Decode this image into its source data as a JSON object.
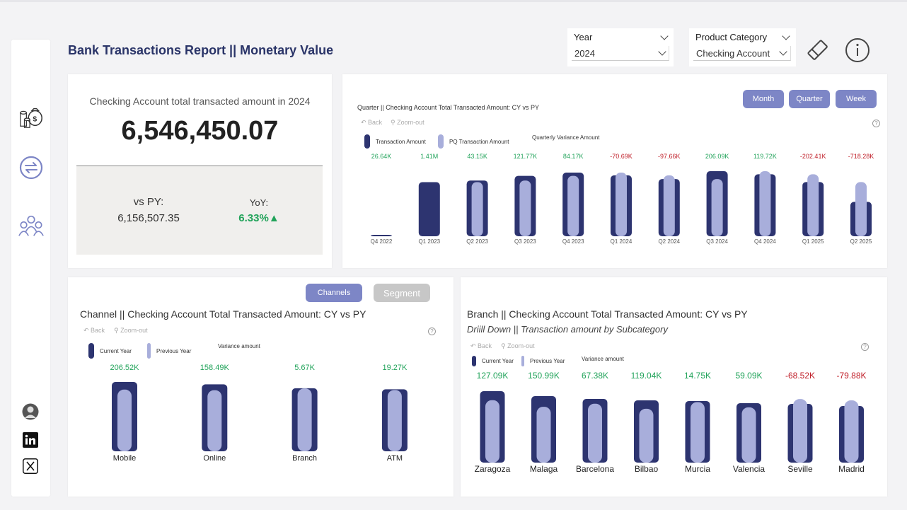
{
  "header": {
    "title": "Bank Transactions Report || Monetary Value"
  },
  "filters": {
    "year": {
      "label": "Year",
      "value": "2024"
    },
    "product": {
      "label": "Product Category",
      "value": "Checking Account"
    }
  },
  "sidebar": {
    "icons": [
      "money-bags-icon",
      "exchange-icon",
      "people-group-icon"
    ],
    "social": [
      "avatar",
      "linkedin-icon",
      "x-twitter-icon"
    ]
  },
  "kpi": {
    "subtitle": "Checking Account total transacted amount in 2024",
    "main_value": "6,546,450.07",
    "vs_label": "vs PY:",
    "vs_value": "6,156,507.35",
    "yoy_label": "YoY:",
    "yoy_value": "6.33%▲"
  },
  "buttons": {
    "month": "Month",
    "quarter": "Quarter",
    "week": "Week",
    "channels": "Channels",
    "segment": "Segment"
  },
  "nav": {
    "back": "Back",
    "zoom_out": "Zoom-out",
    "help": "?"
  },
  "colors": {
    "current": "#2d3470",
    "previous": "#a8aedb",
    "positive": "#21a35a",
    "negative": "#c0202a",
    "accent": "#7d86c6"
  },
  "chart_data": [
    {
      "type": "bar",
      "title": "Quarter || Checking Account Total Transacted Amount: CY vs PY",
      "legend": [
        "Transaction Amount",
        "PQ Transaction Amount",
        "Quarterly Variance Amount"
      ],
      "categories": [
        "Q4 2022",
        "Q1 2023",
        "Q2 2023",
        "Q3 2023",
        "Q4 2023",
        "Q1 2024",
        "Q2 2024",
        "Q3 2024",
        "Q4 2024",
        "Q1 2025",
        "Q2 2025"
      ],
      "series": [
        {
          "name": "Transaction Amount",
          "values": [
            26640,
            1410000,
            1453150,
            1574910,
            1659080,
            1588390,
            1490730,
            1696820,
            1616540,
            1414130,
            895850
          ]
        },
        {
          "name": "PQ Transaction Amount",
          "values": [
            0,
            0,
            1410000,
            1453150,
            1574910,
            1659080,
            1588390,
            1490730,
            1696820,
            1616540,
            1414130
          ]
        }
      ],
      "variance_labels": [
        "26.64K",
        "1.41M",
        "43.15K",
        "121.77K",
        "84.17K",
        "-70.69K",
        "-97.66K",
        "206.09K",
        "119.72K",
        "-202.41K",
        "-718.28K"
      ]
    },
    {
      "type": "bar",
      "title": "Channel || Checking Account Total Transacted Amount: CY vs PY",
      "legend": [
        "Current Year",
        "Previous Year",
        "Variance amount"
      ],
      "categories": [
        "Mobile",
        "Online",
        "Branch",
        "ATM"
      ],
      "series": [
        {
          "name": "Current Year",
          "values": [
            1880000,
            1815000,
            1710000,
            1680000
          ]
        },
        {
          "name": "Previous Year",
          "values": [
            1673000,
            1656500,
            1704300,
            1660700
          ]
        }
      ],
      "variance_labels": [
        "206.52K",
        "158.49K",
        "5.67K",
        "19.27K"
      ]
    },
    {
      "type": "bar",
      "title": "Branch || Checking Account Total Transacted Amount: CY vs PY",
      "subtitle": "Driill Down || Transaction amount by Subcategory",
      "legend": [
        "Current Year",
        "Previous Year",
        "Variance amount"
      ],
      "categories": [
        "Zaragoza",
        "Malaga",
        "Barcelona",
        "Bilbao",
        "Murcia",
        "Valencia",
        "Seville",
        "Madrid"
      ],
      "series": [
        {
          "name": "Current Year",
          "values": [
            1010000,
            940000,
            900000,
            880000,
            870000,
            840000,
            830000,
            800000
          ]
        },
        {
          "name": "Previous Year",
          "values": [
            882900,
            789000,
            832600,
            761000,
            855200,
            780900,
            898500,
            879900
          ]
        }
      ],
      "variance_labels": [
        "127.09K",
        "150.99K",
        "67.38K",
        "119.04K",
        "14.75K",
        "59.09K",
        "-68.52K",
        "-79.88K"
      ]
    }
  ]
}
